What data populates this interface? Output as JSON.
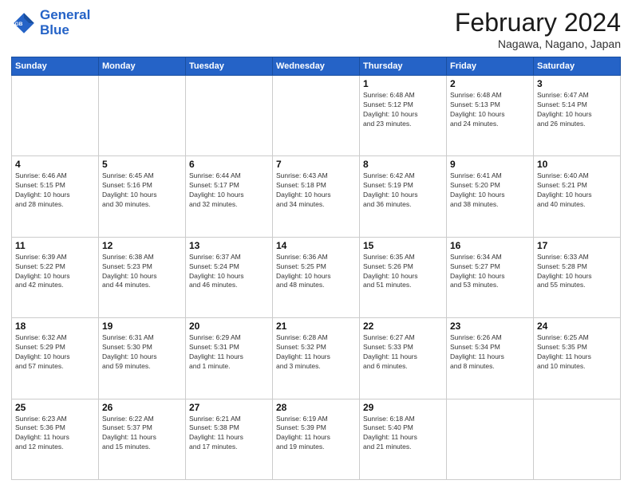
{
  "header": {
    "logo_line1": "General",
    "logo_line2": "Blue",
    "month": "February 2024",
    "location": "Nagawa, Nagano, Japan"
  },
  "days_of_week": [
    "Sunday",
    "Monday",
    "Tuesday",
    "Wednesday",
    "Thursday",
    "Friday",
    "Saturday"
  ],
  "weeks": [
    [
      {
        "day": "",
        "info": ""
      },
      {
        "day": "",
        "info": ""
      },
      {
        "day": "",
        "info": ""
      },
      {
        "day": "",
        "info": ""
      },
      {
        "day": "1",
        "info": "Sunrise: 6:48 AM\nSunset: 5:12 PM\nDaylight: 10 hours\nand 23 minutes."
      },
      {
        "day": "2",
        "info": "Sunrise: 6:48 AM\nSunset: 5:13 PM\nDaylight: 10 hours\nand 24 minutes."
      },
      {
        "day": "3",
        "info": "Sunrise: 6:47 AM\nSunset: 5:14 PM\nDaylight: 10 hours\nand 26 minutes."
      }
    ],
    [
      {
        "day": "4",
        "info": "Sunrise: 6:46 AM\nSunset: 5:15 PM\nDaylight: 10 hours\nand 28 minutes."
      },
      {
        "day": "5",
        "info": "Sunrise: 6:45 AM\nSunset: 5:16 PM\nDaylight: 10 hours\nand 30 minutes."
      },
      {
        "day": "6",
        "info": "Sunrise: 6:44 AM\nSunset: 5:17 PM\nDaylight: 10 hours\nand 32 minutes."
      },
      {
        "day": "7",
        "info": "Sunrise: 6:43 AM\nSunset: 5:18 PM\nDaylight: 10 hours\nand 34 minutes."
      },
      {
        "day": "8",
        "info": "Sunrise: 6:42 AM\nSunset: 5:19 PM\nDaylight: 10 hours\nand 36 minutes."
      },
      {
        "day": "9",
        "info": "Sunrise: 6:41 AM\nSunset: 5:20 PM\nDaylight: 10 hours\nand 38 minutes."
      },
      {
        "day": "10",
        "info": "Sunrise: 6:40 AM\nSunset: 5:21 PM\nDaylight: 10 hours\nand 40 minutes."
      }
    ],
    [
      {
        "day": "11",
        "info": "Sunrise: 6:39 AM\nSunset: 5:22 PM\nDaylight: 10 hours\nand 42 minutes."
      },
      {
        "day": "12",
        "info": "Sunrise: 6:38 AM\nSunset: 5:23 PM\nDaylight: 10 hours\nand 44 minutes."
      },
      {
        "day": "13",
        "info": "Sunrise: 6:37 AM\nSunset: 5:24 PM\nDaylight: 10 hours\nand 46 minutes."
      },
      {
        "day": "14",
        "info": "Sunrise: 6:36 AM\nSunset: 5:25 PM\nDaylight: 10 hours\nand 48 minutes."
      },
      {
        "day": "15",
        "info": "Sunrise: 6:35 AM\nSunset: 5:26 PM\nDaylight: 10 hours\nand 51 minutes."
      },
      {
        "day": "16",
        "info": "Sunrise: 6:34 AM\nSunset: 5:27 PM\nDaylight: 10 hours\nand 53 minutes."
      },
      {
        "day": "17",
        "info": "Sunrise: 6:33 AM\nSunset: 5:28 PM\nDaylight: 10 hours\nand 55 minutes."
      }
    ],
    [
      {
        "day": "18",
        "info": "Sunrise: 6:32 AM\nSunset: 5:29 PM\nDaylight: 10 hours\nand 57 minutes."
      },
      {
        "day": "19",
        "info": "Sunrise: 6:31 AM\nSunset: 5:30 PM\nDaylight: 10 hours\nand 59 minutes."
      },
      {
        "day": "20",
        "info": "Sunrise: 6:29 AM\nSunset: 5:31 PM\nDaylight: 11 hours\nand 1 minute."
      },
      {
        "day": "21",
        "info": "Sunrise: 6:28 AM\nSunset: 5:32 PM\nDaylight: 11 hours\nand 3 minutes."
      },
      {
        "day": "22",
        "info": "Sunrise: 6:27 AM\nSunset: 5:33 PM\nDaylight: 11 hours\nand 6 minutes."
      },
      {
        "day": "23",
        "info": "Sunrise: 6:26 AM\nSunset: 5:34 PM\nDaylight: 11 hours\nand 8 minutes."
      },
      {
        "day": "24",
        "info": "Sunrise: 6:25 AM\nSunset: 5:35 PM\nDaylight: 11 hours\nand 10 minutes."
      }
    ],
    [
      {
        "day": "25",
        "info": "Sunrise: 6:23 AM\nSunset: 5:36 PM\nDaylight: 11 hours\nand 12 minutes."
      },
      {
        "day": "26",
        "info": "Sunrise: 6:22 AM\nSunset: 5:37 PM\nDaylight: 11 hours\nand 15 minutes."
      },
      {
        "day": "27",
        "info": "Sunrise: 6:21 AM\nSunset: 5:38 PM\nDaylight: 11 hours\nand 17 minutes."
      },
      {
        "day": "28",
        "info": "Sunrise: 6:19 AM\nSunset: 5:39 PM\nDaylight: 11 hours\nand 19 minutes."
      },
      {
        "day": "29",
        "info": "Sunrise: 6:18 AM\nSunset: 5:40 PM\nDaylight: 11 hours\nand 21 minutes."
      },
      {
        "day": "",
        "info": ""
      },
      {
        "day": "",
        "info": ""
      }
    ]
  ]
}
